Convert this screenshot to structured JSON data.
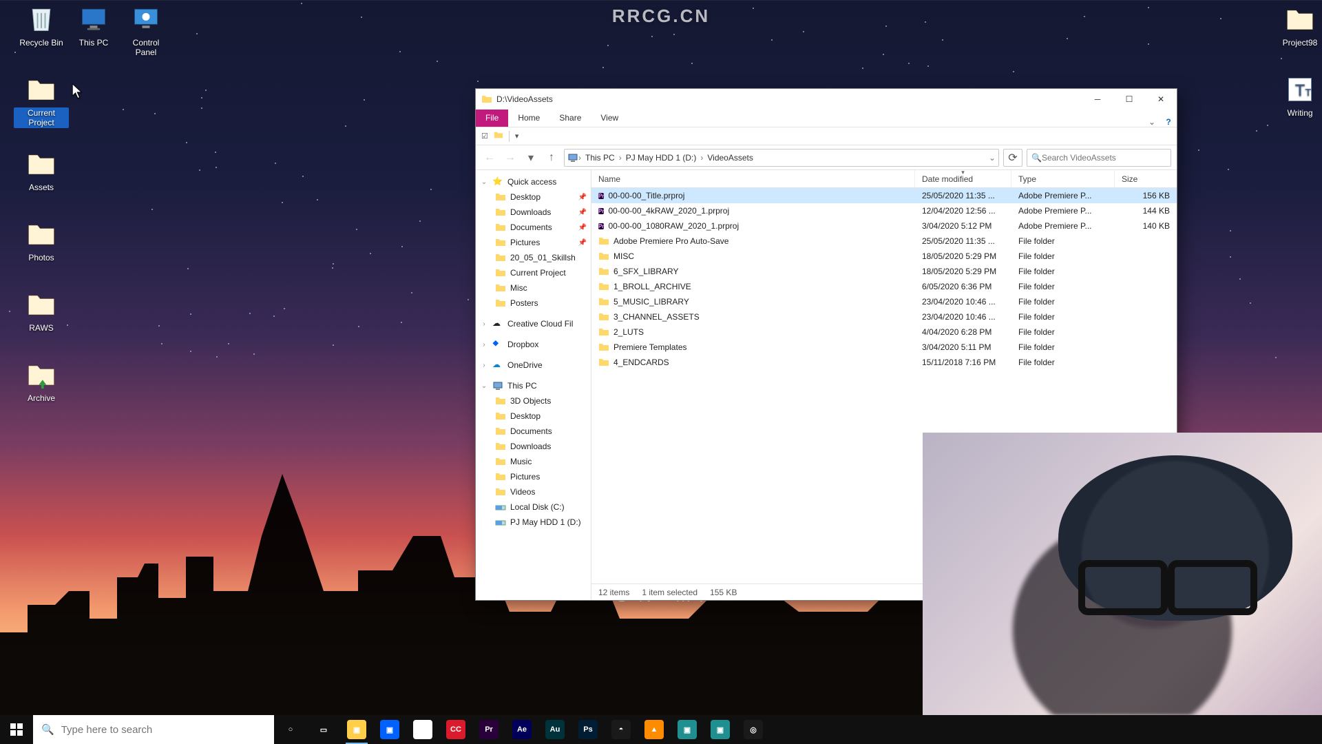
{
  "watermark": "RRCG.CN",
  "wallpaper_text": "IRON MAN",
  "desktop_icons_left": [
    {
      "name": "recycle-bin",
      "label": "Recycle Bin",
      "icon": "recycle"
    },
    {
      "name": "this-pc",
      "label": "This PC",
      "icon": "pc"
    },
    {
      "name": "control-panel",
      "label": "Control Panel",
      "icon": "cpl"
    },
    {
      "name": "current-project",
      "label": "Current Project",
      "icon": "folder",
      "selected": true
    },
    {
      "name": "assets",
      "label": "Assets",
      "icon": "folder"
    },
    {
      "name": "photos",
      "label": "Photos",
      "icon": "folder"
    },
    {
      "name": "raws",
      "label": "RAWS",
      "icon": "folder"
    },
    {
      "name": "archive",
      "label": "Archive",
      "icon": "archive"
    }
  ],
  "desktop_icons_right": [
    {
      "name": "project98",
      "label": "Project98",
      "icon": "folder"
    },
    {
      "name": "writing",
      "label": "Writing",
      "icon": "font"
    }
  ],
  "explorer": {
    "title": "D:\\VideoAssets",
    "tabs": {
      "file": "File",
      "home": "Home",
      "share": "Share",
      "view": "View"
    },
    "breadcrumb": [
      "This PC",
      "PJ May HDD 1 (D:)",
      "VideoAssets"
    ],
    "search_placeholder": "Search VideoAssets",
    "columns": {
      "name": "Name",
      "date": "Date modified",
      "type": "Type",
      "size": "Size"
    },
    "nav": {
      "quick_access": "Quick access",
      "qa_items": [
        "Desktop",
        "Downloads",
        "Documents",
        "Pictures",
        "20_05_01_Skillsh",
        "Current Project",
        "Misc",
        "Posters"
      ],
      "creative_cloud": "Creative Cloud Fil",
      "dropbox": "Dropbox",
      "onedrive": "OneDrive",
      "this_pc": "This PC",
      "pc_items": [
        "3D Objects",
        "Desktop",
        "Documents",
        "Downloads",
        "Music",
        "Pictures",
        "Videos",
        "Local Disk (C:)",
        "PJ May HDD 1 (D:)"
      ]
    },
    "files": [
      {
        "name": "00-00-00_Title.prproj",
        "date": "25/05/2020 11:35 ...",
        "type": "Adobe Premiere P...",
        "size": "156 KB",
        "icon": "pr",
        "selected": true
      },
      {
        "name": "00-00-00_4kRAW_2020_1.prproj",
        "date": "12/04/2020 12:56 ...",
        "type": "Adobe Premiere P...",
        "size": "144 KB",
        "icon": "pr"
      },
      {
        "name": "00-00-00_1080RAW_2020_1.prproj",
        "date": "3/04/2020 5:12 PM",
        "type": "Adobe Premiere P...",
        "size": "140 KB",
        "icon": "pr"
      },
      {
        "name": "Adobe Premiere Pro Auto-Save",
        "date": "25/05/2020 11:35 ...",
        "type": "File folder",
        "size": "",
        "icon": "folder"
      },
      {
        "name": "MISC",
        "date": "18/05/2020 5:29 PM",
        "type": "File folder",
        "size": "",
        "icon": "folder"
      },
      {
        "name": "6_SFX_LIBRARY",
        "date": "18/05/2020 5:29 PM",
        "type": "File folder",
        "size": "",
        "icon": "folder"
      },
      {
        "name": "1_BROLL_ARCHIVE",
        "date": "6/05/2020 6:36 PM",
        "type": "File folder",
        "size": "",
        "icon": "folder"
      },
      {
        "name": "5_MUSIC_LIBRARY",
        "date": "23/04/2020 10:46 ...",
        "type": "File folder",
        "size": "",
        "icon": "folder"
      },
      {
        "name": "3_CHANNEL_ASSETS",
        "date": "23/04/2020 10:46 ...",
        "type": "File folder",
        "size": "",
        "icon": "folder"
      },
      {
        "name": "2_LUTS",
        "date": "4/04/2020 6:28 PM",
        "type": "File folder",
        "size": "",
        "icon": "folder"
      },
      {
        "name": "Premiere Templates",
        "date": "3/04/2020 5:11 PM",
        "type": "File folder",
        "size": "",
        "icon": "folder"
      },
      {
        "name": "4_ENDCARDS",
        "date": "15/11/2018 7:16 PM",
        "type": "File folder",
        "size": "",
        "icon": "folder"
      }
    ],
    "status": {
      "count": "12 items",
      "selected": "1 item selected",
      "size": "155 KB"
    }
  },
  "taskbar": {
    "search_placeholder": "Type here to search",
    "items": [
      {
        "name": "cortana",
        "color": "#101010",
        "label": "○"
      },
      {
        "name": "task-view",
        "color": "#101010",
        "label": "▭"
      },
      {
        "name": "explorer",
        "color": "#ffcf4a",
        "label": "▣",
        "active": true
      },
      {
        "name": "dropbox",
        "color": "#0061ff",
        "label": "▣"
      },
      {
        "name": "chrome",
        "color": "#fff",
        "label": "◉"
      },
      {
        "name": "creative-cloud",
        "color": "#da1b2e",
        "label": "CC"
      },
      {
        "name": "premiere",
        "color": "#2a003b",
        "label": "Pr"
      },
      {
        "name": "after-effects",
        "color": "#00005b",
        "label": "Ae"
      },
      {
        "name": "audition",
        "color": "#00323b",
        "label": "Au"
      },
      {
        "name": "photoshop",
        "color": "#001d34",
        "label": "Ps"
      },
      {
        "name": "davinci",
        "color": "#1a1a1a",
        "label": "◓"
      },
      {
        "name": "vlc",
        "color": "#ff8c00",
        "label": "▲"
      },
      {
        "name": "app-teal1",
        "color": "#1f8f8f",
        "label": "▣"
      },
      {
        "name": "app-teal2",
        "color": "#1f8f8f",
        "label": "▣"
      },
      {
        "name": "obs",
        "color": "#1a1a1a",
        "label": "◎"
      }
    ]
  }
}
